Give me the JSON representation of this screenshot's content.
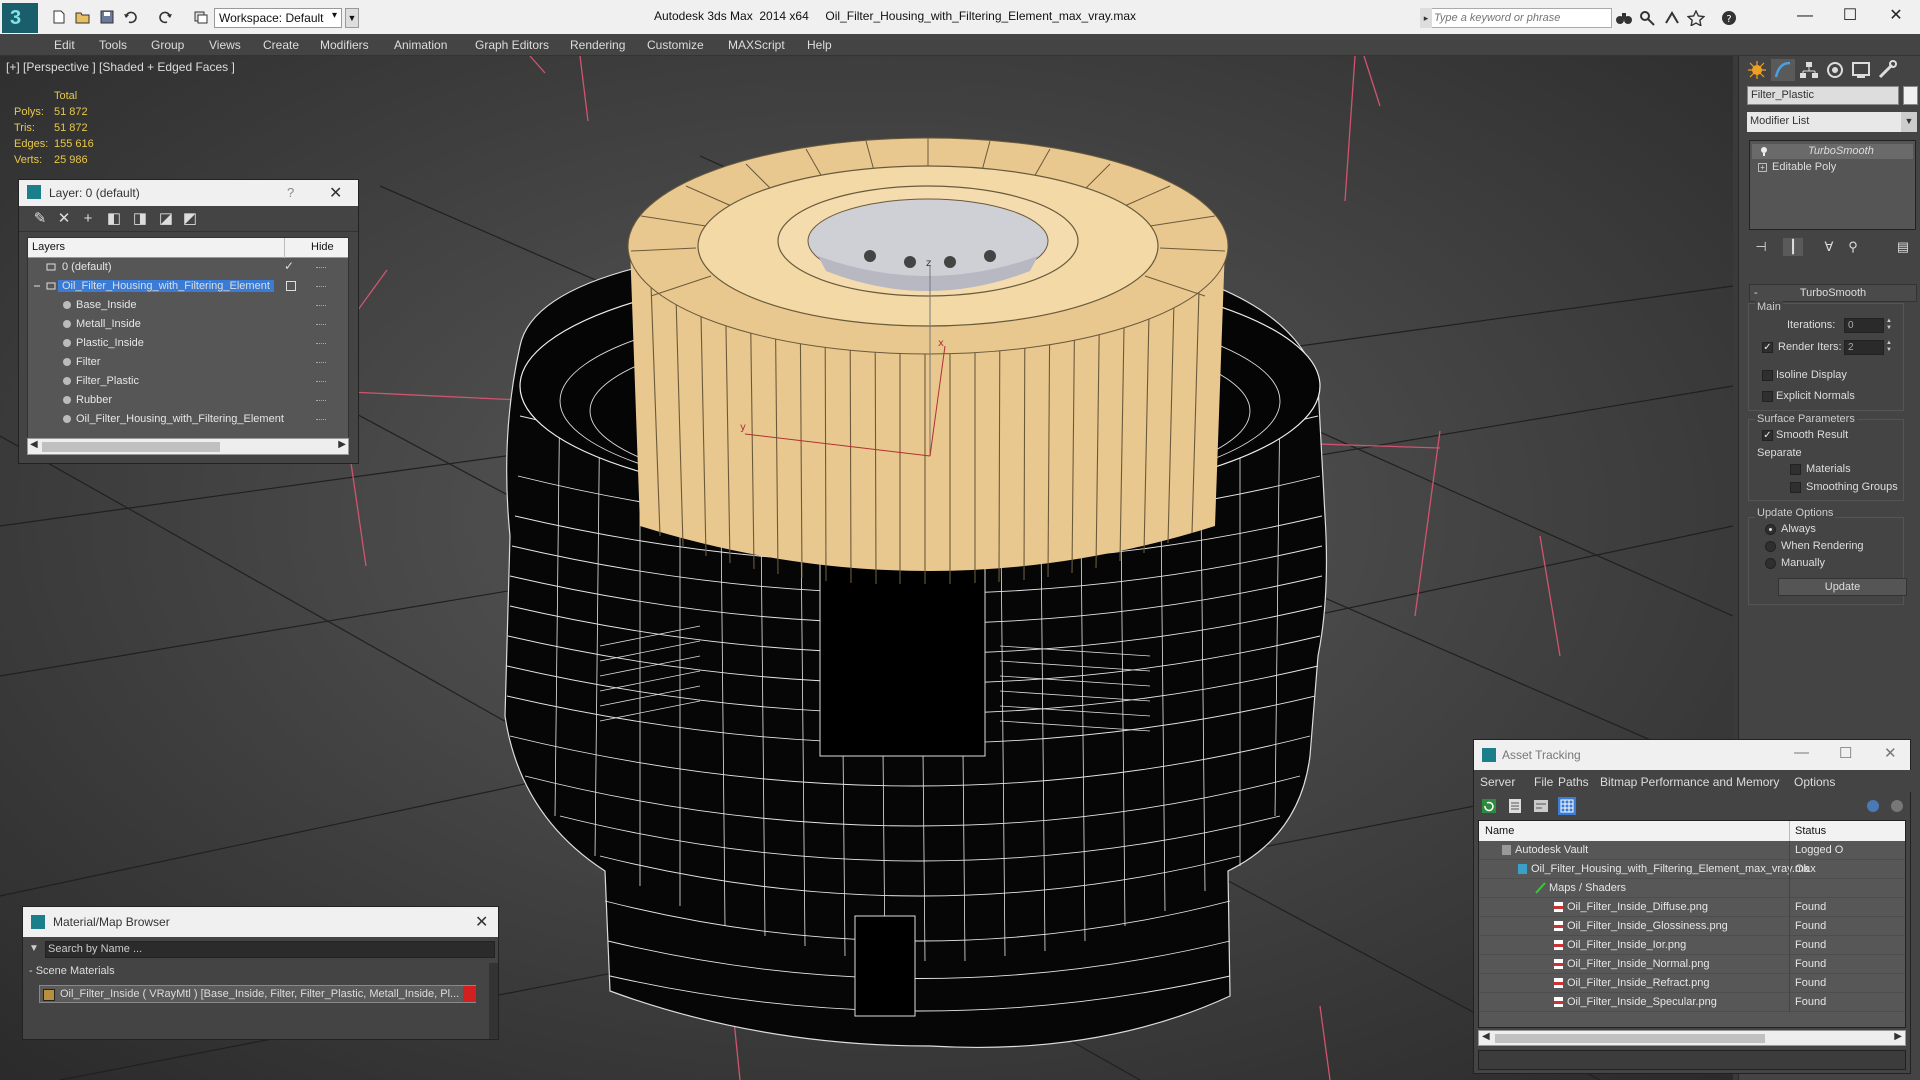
{
  "app": {
    "title": "Autodesk 3ds Max  2014 x64     Oil_Filter_Housing_with_Filtering_Element_max_vray.max",
    "logo_letter": "3",
    "workspace": "Workspace: Default",
    "search_placeholder": "Type a keyword or phrase"
  },
  "menu": [
    "Edit",
    "Tools",
    "Group",
    "Views",
    "Create",
    "Modifiers",
    "Animation",
    "Graph Editors",
    "Rendering",
    "Customize",
    "MAXScript",
    "Help"
  ],
  "viewport": {
    "label": "[+] [Perspective ] [Shaded + Edged Faces ]",
    "stats": {
      "header": "Total",
      "rows": [
        {
          "k": "Polys:",
          "v": "51 872"
        },
        {
          "k": "Tris:",
          "v": "51 872"
        },
        {
          "k": "Edges:",
          "v": "155 616"
        },
        {
          "k": "Verts:",
          "v": "25 986"
        }
      ]
    },
    "axis_labels": {
      "x": "x",
      "y": "y",
      "z": "z"
    }
  },
  "layer_dialog": {
    "title": "Layer: 0 (default)",
    "help": "?",
    "columns": {
      "layers": "Layers",
      "hide": "Hide"
    },
    "rows": [
      {
        "label": "0 (default)",
        "level": 0,
        "selected": false,
        "checked": true
      },
      {
        "label": "Oil_Filter_Housing_with_Filtering_Element",
        "level": 0,
        "selected": true,
        "checked": false
      },
      {
        "label": "Base_Inside",
        "level": 1
      },
      {
        "label": "Metall_Inside",
        "level": 1
      },
      {
        "label": "Plastic_Inside",
        "level": 1
      },
      {
        "label": "Filter",
        "level": 1
      },
      {
        "label": "Filter_Plastic",
        "level": 1
      },
      {
        "label": "Rubber",
        "level": 1
      },
      {
        "label": "Oil_Filter_Housing_with_Filtering_Element",
        "level": 1
      }
    ]
  },
  "material_browser": {
    "title": "Material/Map Browser",
    "search": "Search by Name ...",
    "section": "- Scene Materials",
    "item": "Oil_Filter_Inside  ( VRayMtl )  [Base_Inside, Filter, Filter_Plastic, Metall_Inside, Pl..."
  },
  "command_panel": {
    "object_name": "Filter_Plastic",
    "modifier_list": "Modifier List",
    "stack": [
      "TurboSmooth",
      "Editable Poly"
    ],
    "turbosmooth": {
      "header": "TurboSmooth",
      "main": "Main",
      "iterations_label": "Iterations:",
      "iterations": "0",
      "render_iters_label": "Render Iters:",
      "render_iters": "2",
      "render_iters_checked": true,
      "isoline": "Isoline Display",
      "explicit": "Explicit Normals",
      "surface": "Surface Parameters",
      "smooth_result": "Smooth Result",
      "separate": "Separate",
      "materials": "Materials",
      "smoothing_groups": "Smoothing Groups",
      "update_options": "Update Options",
      "always": "Always",
      "when_rendering": "When Rendering",
      "manually": "Manually",
      "update": "Update"
    }
  },
  "asset_tracking": {
    "title": "Asset Tracking",
    "menu": [
      "Server",
      "File",
      "Paths",
      "Bitmap Performance and Memory",
      "Options"
    ],
    "columns": {
      "name": "Name",
      "status": "Status"
    },
    "rows": [
      {
        "name": "Autodesk Vault",
        "status": "Logged O",
        "level": 1,
        "icon": "vault-icon"
      },
      {
        "name": "Oil_Filter_Housing_with_Filtering_Element_max_vray.max",
        "status": "Ok",
        "level": 2,
        "icon": "max-file-icon"
      },
      {
        "name": "Maps / Shaders",
        "status": "",
        "level": 3,
        "icon": "maps-icon"
      },
      {
        "name": "Oil_Filter_Inside_Diffuse.png",
        "status": "Found",
        "level": 4,
        "icon": "png-icon"
      },
      {
        "name": "Oil_Filter_Inside_Glossiness.png",
        "status": "Found",
        "level": 4,
        "icon": "png-icon"
      },
      {
        "name": "Oil_Filter_Inside_Ior.png",
        "status": "Found",
        "level": 4,
        "icon": "png-icon"
      },
      {
        "name": "Oil_Filter_Inside_Normal.png",
        "status": "Found",
        "level": 4,
        "icon": "png-icon"
      },
      {
        "name": "Oil_Filter_Inside_Refract.png",
        "status": "Found",
        "level": 4,
        "icon": "png-icon"
      },
      {
        "name": "Oil_Filter_Inside_Specular.png",
        "status": "Found",
        "level": 4,
        "icon": "png-icon"
      }
    ]
  },
  "colors": {
    "stats": "#e8c84a",
    "selection": "#3a7bd5",
    "filter_tan": "#e9c88f",
    "wire": "#ffffff",
    "grid_axis": "#d0546e"
  }
}
